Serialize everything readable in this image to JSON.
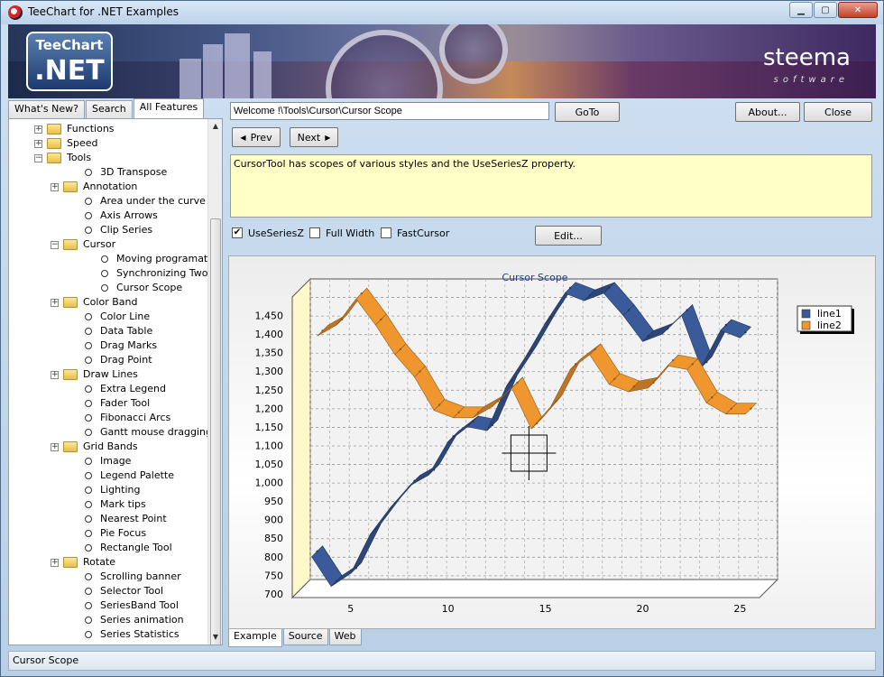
{
  "window": {
    "title": "TeeChart for .NET Examples"
  },
  "banner": {
    "logo_top": "TeeChart",
    "logo_bottom": ".NET",
    "brand": "steema",
    "brand_sub": "software"
  },
  "left_tabs": [
    "What's New?",
    "Search",
    "All Features"
  ],
  "tree": [
    {
      "label": "Functions",
      "level": 0,
      "type": "folder",
      "exp": "+"
    },
    {
      "label": "Speed",
      "level": 0,
      "type": "folder",
      "exp": "+"
    },
    {
      "label": "Tools",
      "level": 0,
      "type": "folder-open",
      "exp": "-"
    },
    {
      "label": "3D Transpose",
      "level": 1,
      "type": "leaf"
    },
    {
      "label": "Annotation",
      "level": 1,
      "type": "folder",
      "exp": "+"
    },
    {
      "label": "Area under the curve",
      "level": 1,
      "type": "leaf"
    },
    {
      "label": "Axis Arrows",
      "level": 1,
      "type": "leaf"
    },
    {
      "label": "Clip Series",
      "level": 1,
      "type": "leaf"
    },
    {
      "label": "Cursor",
      "level": 1,
      "type": "folder-open",
      "exp": "-"
    },
    {
      "label": "Moving programatically",
      "level": 2,
      "type": "leaf"
    },
    {
      "label": "Synchronizing Two",
      "level": 2,
      "type": "leaf"
    },
    {
      "label": "Cursor Scope",
      "level": 2,
      "type": "leaf"
    },
    {
      "label": "Color Band",
      "level": 1,
      "type": "folder",
      "exp": "+"
    },
    {
      "label": "Color Line",
      "level": 1,
      "type": "leaf"
    },
    {
      "label": "Data Table",
      "level": 1,
      "type": "leaf"
    },
    {
      "label": "Drag Marks",
      "level": 1,
      "type": "leaf"
    },
    {
      "label": "Drag Point",
      "level": 1,
      "type": "leaf"
    },
    {
      "label": "Draw Lines",
      "level": 1,
      "type": "folder",
      "exp": "+"
    },
    {
      "label": "Extra Legend",
      "level": 1,
      "type": "leaf"
    },
    {
      "label": "Fader Tool",
      "level": 1,
      "type": "leaf"
    },
    {
      "label": "Fibonacci Arcs",
      "level": 1,
      "type": "leaf"
    },
    {
      "label": "Gantt mouse dragging",
      "level": 1,
      "type": "leaf"
    },
    {
      "label": "Grid Bands",
      "level": 1,
      "type": "folder",
      "exp": "+"
    },
    {
      "label": "Image",
      "level": 1,
      "type": "leaf"
    },
    {
      "label": "Legend Palette",
      "level": 1,
      "type": "leaf"
    },
    {
      "label": "Lighting",
      "level": 1,
      "type": "leaf"
    },
    {
      "label": "Mark tips",
      "level": 1,
      "type": "leaf"
    },
    {
      "label": "Nearest Point",
      "level": 1,
      "type": "leaf"
    },
    {
      "label": "Pie Focus",
      "level": 1,
      "type": "leaf"
    },
    {
      "label": "Rectangle Tool",
      "level": 1,
      "type": "leaf"
    },
    {
      "label": "Rotate",
      "level": 1,
      "type": "folder",
      "exp": "+"
    },
    {
      "label": "Scrolling banner",
      "level": 1,
      "type": "leaf"
    },
    {
      "label": "Selector Tool",
      "level": 1,
      "type": "leaf"
    },
    {
      "label": "SeriesBand Tool",
      "level": 1,
      "type": "leaf"
    },
    {
      "label": "Series animation",
      "level": 1,
      "type": "leaf"
    },
    {
      "label": "Series Statistics",
      "level": 1,
      "type": "leaf"
    }
  ],
  "toolbar": {
    "path": "Welcome !\\Tools\\Cursor\\Cursor Scope",
    "goto": "GoTo",
    "about": "About...",
    "close": "Close",
    "prev": "Prev",
    "next": "Next"
  },
  "description": "CursorTool has scopes of various styles and the UseSeriesZ property.",
  "options": {
    "use_series_z": "UseSeriesZ",
    "use_series_z_checked": true,
    "full_width": "Full Width",
    "full_width_checked": false,
    "fast_cursor": "FastCursor",
    "fast_cursor_checked": false,
    "edit": "Edit..."
  },
  "bottom_tabs": [
    "Example",
    "Source",
    "Web"
  ],
  "status": "Cursor Scope",
  "chart_data": {
    "type": "line",
    "title": "Cursor Scope",
    "xlim": [
      2,
      26
    ],
    "ylim": [
      690,
      1500
    ],
    "x_ticks": [
      5,
      10,
      15,
      20,
      25
    ],
    "y_ticks": [
      700,
      750,
      800,
      850,
      900,
      950,
      1000,
      1050,
      1100,
      1150,
      1200,
      1250,
      1300,
      1350,
      1400,
      1450
    ],
    "y_tick_labels": [
      "700",
      "750",
      "800",
      "850",
      "900",
      "950",
      "1,000",
      "1,050",
      "1,100",
      "1,150",
      "1,200",
      "1,250",
      "1,300",
      "1,350",
      "1,400",
      "1,450"
    ],
    "grid": true,
    "legend": "top-right",
    "series": [
      {
        "name": "line1",
        "color": "#3a5a9a",
        "x": [
          3,
          4,
          5,
          6,
          7,
          8,
          9,
          10,
          11,
          12,
          13,
          14,
          15,
          16,
          17,
          18,
          19,
          20,
          21,
          22,
          23,
          24,
          25
        ],
        "y": [
          800,
          720,
          755,
          860,
          930,
          990,
          1020,
          1110,
          1150,
          1140,
          1260,
          1340,
          1430,
          1510,
          1490,
          1510,
          1450,
          1380,
          1400,
          1450,
          1310,
          1410,
          1390
        ]
      },
      {
        "name": "line2",
        "color": "#f0962e",
        "x": [
          3,
          4,
          5,
          6,
          7,
          8,
          9,
          10,
          11,
          12,
          13,
          14,
          15,
          16,
          17,
          18,
          19,
          20,
          21,
          22,
          23,
          24,
          25
        ],
        "y": [
          1380,
          1410,
          1480,
          1410,
          1330,
          1270,
          1180,
          1160,
          1160,
          1190,
          1240,
          1130,
          1190,
          1290,
          1330,
          1250,
          1230,
          1240,
          1300,
          1290,
          1200,
          1170,
          1170
        ]
      }
    ],
    "cursor": {
      "x": 13.6,
      "y": 1050
    }
  }
}
